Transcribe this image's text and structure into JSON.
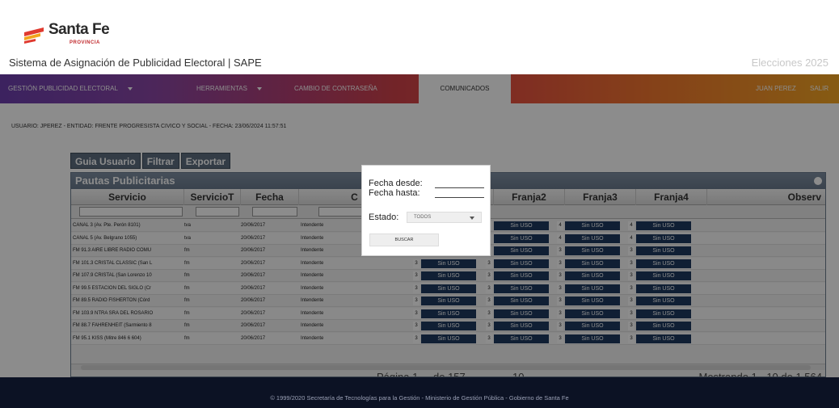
{
  "brand": {
    "name": "Santa Fe",
    "subtitle": "PROVINCIA"
  },
  "header": {
    "system_title": "Sistema de Asignación de Publicidad Electoral | SAPE",
    "election": "Elecciones 2025"
  },
  "nav": {
    "items": [
      "GESTIÓN PUBLICIDAD ELECTORAL",
      "HERRAMIENTAS",
      "CAMBIO DE CONTRASEÑA",
      "COMUNICADOS"
    ],
    "user": "JUAN PEREZ",
    "logout": "SALIR"
  },
  "user_info": "USUARIO: JPEREZ - ENTIDAD: FRENTE PROGRESISTA CIVICO Y SOCIAL - FECHA: 23/06/2024 11:57:51",
  "toolbar": {
    "guide": "Guia Usuario",
    "filter": "Filtrar",
    "export": "Exportar"
  },
  "grid": {
    "caption": "Pautas Publicitarias",
    "columns": [
      "Servicio",
      "ServicioT",
      "Fecha",
      "C",
      "",
      "Franja2",
      "Franja3",
      "Franja4",
      "Observ"
    ],
    "cell_value": "Sin USO",
    "rows": [
      {
        "servicio": "CANAL 3 (Av. Pte. Perón 8101)",
        "tipo": "tva",
        "fecha": "20/06/2017",
        "cargo": "Intendente",
        "n1": "",
        "n2": "3",
        "n3": "4",
        "n4": "4"
      },
      {
        "servicio": "CANAL 5  (Av. Belgrano 1055)",
        "tipo": "tva",
        "fecha": "20/06/2017",
        "cargo": "Intendente",
        "n1": "",
        "n2": "3",
        "n3": "4",
        "n4": "4"
      },
      {
        "servicio": "FM 91.3 AIRE LIBRE RADIO COMU",
        "tipo": "fm",
        "fecha": "20/06/2017",
        "cargo": "Intendente",
        "n1": "3",
        "n2": "3",
        "n3": "3",
        "n4": "3"
      },
      {
        "servicio": "FM 101.3 CRISTAL CLASSIC (San L",
        "tipo": "fm",
        "fecha": "20/06/2017",
        "cargo": "Intendente",
        "n1": "3",
        "n2": "3",
        "n3": "3",
        "n4": "3"
      },
      {
        "servicio": "FM 107.9 CRISTAL (San Lorenzo 10",
        "tipo": "fm",
        "fecha": "20/06/2017",
        "cargo": "Intendente",
        "n1": "3",
        "n2": "3",
        "n3": "3",
        "n4": "3"
      },
      {
        "servicio": "FM 99.5 ESTACION DEL SIGLO (Cr",
        "tipo": "fm",
        "fecha": "20/06/2017",
        "cargo": "Intendente",
        "n1": "3",
        "n2": "3",
        "n3": "3",
        "n4": "3"
      },
      {
        "servicio": "FM 89.5 RADIO FISHERTON (Córd",
        "tipo": "fm",
        "fecha": "20/06/2017",
        "cargo": "Intendente",
        "n1": "3",
        "n2": "3",
        "n3": "3",
        "n4": "3"
      },
      {
        "servicio": "FM 103.9 NTRA SRA DEL ROSARIO",
        "tipo": "fm",
        "fecha": "20/06/2017",
        "cargo": "Intendente",
        "n1": "3",
        "n2": "3",
        "n3": "3",
        "n4": "3"
      },
      {
        "servicio": "FM 88.7 FAHRENHEIT (Sarmiento 8",
        "tipo": "fm",
        "fecha": "20/06/2017",
        "cargo": "Intendente",
        "n1": "3",
        "n2": "3",
        "n3": "3",
        "n4": "3"
      },
      {
        "servicio": "FM 95.1 KISS (Mitre 846 6 604)",
        "tipo": "fm",
        "fecha": "20/06/2017",
        "cargo": "Intendente",
        "n1": "3",
        "n2": "3",
        "n3": "3",
        "n4": "3"
      }
    ],
    "pager_page": "Página 1",
    "pager_of": "de 157",
    "pager_size": "10",
    "pager_count": "Mostrando 1 - 10 de 1.564"
  },
  "dialog": {
    "from_label": "Fecha desde:",
    "to_label": "Fecha hasta:",
    "state_label": "Estado:",
    "state_value": "TODOS",
    "search_button": "BUSCAR"
  },
  "footer": "© 1999/2020 Secretaría de Tecnologías para la Gestión - Ministerio de Gestión Pública - Gobierno de Santa Fe",
  "colors": {
    "accent_start": "#6d3fae",
    "accent_end": "#f5a623",
    "cell_bg": "#1e3a5f",
    "footer_bg": "#0c1224"
  },
  "icons": {
    "flag": "santa-fe-flag-icon",
    "caret": "caret-down-icon",
    "close": "close-icon",
    "select_arrow": "chevron-down-icon"
  }
}
